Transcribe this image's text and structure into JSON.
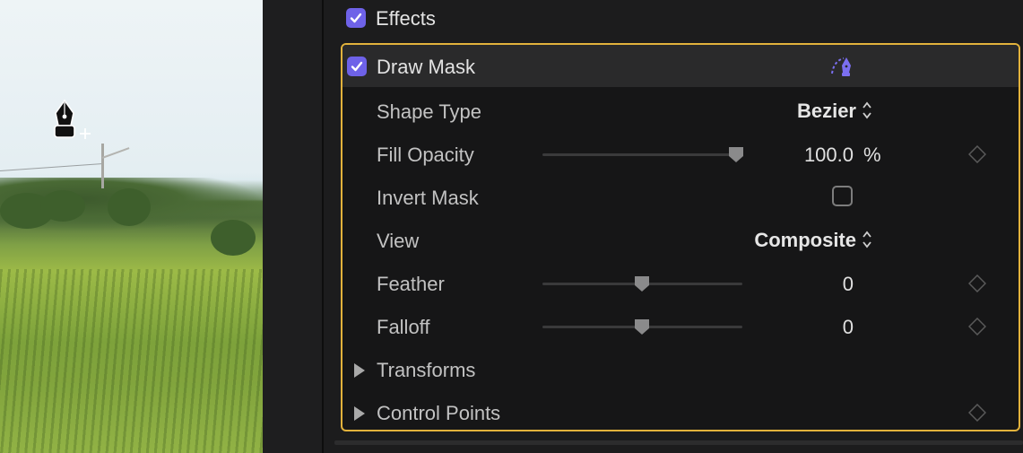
{
  "effects": {
    "label": "Effects",
    "checked": true
  },
  "draw_mask": {
    "title": "Draw Mask",
    "checked": true,
    "tool_icon": "draw-mask-pen-icon",
    "accent_color": "#6e62e8",
    "selection_color": "#e2b23c"
  },
  "params": {
    "shape_type": {
      "label": "Shape Type",
      "value": "Bezier"
    },
    "fill_opacity": {
      "label": "Fill Opacity",
      "value": "100.0",
      "unit": "%",
      "slider_fraction": 1.0
    },
    "invert_mask": {
      "label": "Invert Mask",
      "checked": false
    },
    "view": {
      "label": "View",
      "value": "Composite"
    },
    "feather": {
      "label": "Feather",
      "value": "0",
      "slider_fraction": 0.5
    },
    "falloff": {
      "label": "Falloff",
      "value": "0",
      "slider_fraction": 0.5
    },
    "transforms": {
      "label": "Transforms",
      "expanded": false
    },
    "control_points": {
      "label": "Control Points",
      "expanded": false
    }
  },
  "viewer": {
    "cursor_icon": "pen-add-point-cursor-icon"
  }
}
